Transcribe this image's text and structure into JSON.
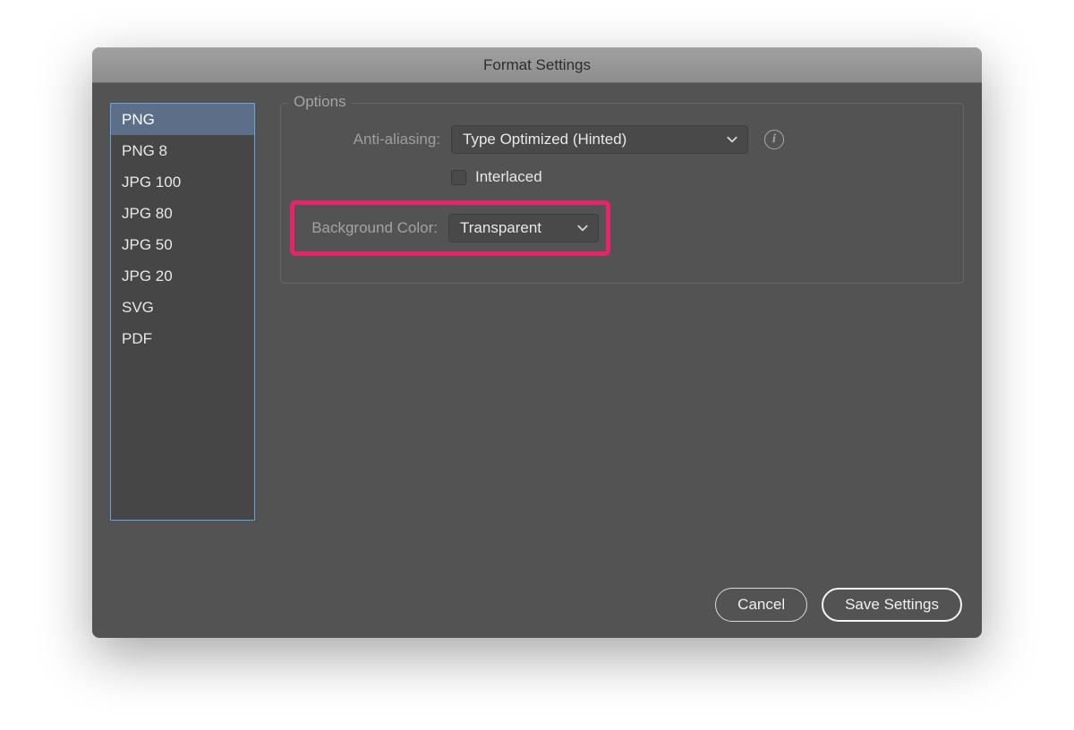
{
  "window": {
    "title": "Format Settings"
  },
  "sidebar": {
    "items": [
      {
        "label": "PNG",
        "selected": true
      },
      {
        "label": "PNG 8",
        "selected": false
      },
      {
        "label": "JPG 100",
        "selected": false
      },
      {
        "label": "JPG 80",
        "selected": false
      },
      {
        "label": "JPG 50",
        "selected": false
      },
      {
        "label": "JPG 20",
        "selected": false
      },
      {
        "label": "SVG",
        "selected": false
      },
      {
        "label": "PDF",
        "selected": false
      }
    ]
  },
  "options": {
    "group_label": "Options",
    "anti_aliasing_label": "Anti-aliasing:",
    "anti_aliasing_value": "Type Optimized (Hinted)",
    "interlaced_label": "Interlaced",
    "interlaced_checked": false,
    "background_color_label": "Background Color:",
    "background_color_value": "Transparent"
  },
  "footer": {
    "cancel_label": "Cancel",
    "save_label": "Save Settings"
  },
  "colors": {
    "highlight": "#e6246a",
    "panel": "#535353",
    "select_bg": "#494949",
    "sidebar_sel": "#5d6e88"
  }
}
